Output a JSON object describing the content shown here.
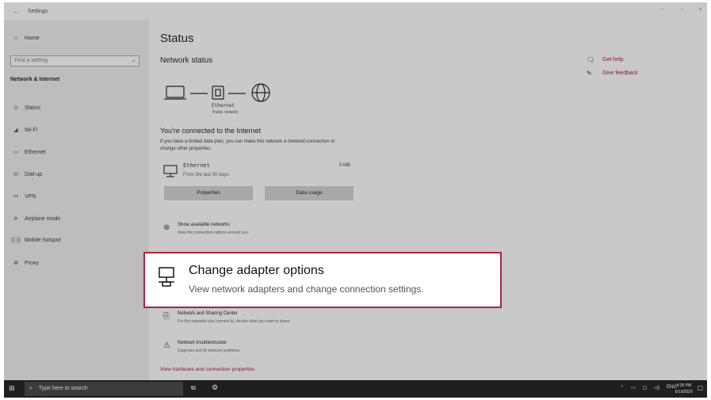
{
  "window": {
    "title": "Settings",
    "back_glyph": "←",
    "minimize": "–",
    "maximize": "▫",
    "close": "×"
  },
  "sidebar": {
    "home": "Home",
    "search_placeholder": "Find a setting",
    "section": "Network & Internet",
    "items": [
      {
        "label": "Status",
        "icon": "status-icon"
      },
      {
        "label": "Wi-Fi",
        "icon": "wifi-icon"
      },
      {
        "label": "Ethernet",
        "icon": "ethernet-icon"
      },
      {
        "label": "Dial-up",
        "icon": "dialup-icon"
      },
      {
        "label": "VPN",
        "icon": "vpn-icon"
      },
      {
        "label": "Airplane mode",
        "icon": "airplane-icon"
      },
      {
        "label": "Mobile hotspot",
        "icon": "hotspot-icon"
      },
      {
        "label": "Proxy",
        "icon": "proxy-icon"
      }
    ]
  },
  "main": {
    "title": "Status",
    "network_status": "Network status",
    "adapter_label": "Ethernet",
    "adapter_sub": "Public network",
    "connected": "You're connected to the Internet",
    "limited_text": "If you have a limited data plan, you can make this network a metered connection or change other properties.",
    "ethernet_row": {
      "name": "Ethernet",
      "sub": "From the last 30 days",
      "usage": "0 MB"
    },
    "buttons": {
      "properties": "Properties",
      "data_usage": "Data usage"
    },
    "show_networks": {
      "title": "Show available networks",
      "sub": "View the connection options around you."
    },
    "sharing_center": {
      "title": "Network and Sharing Center",
      "sub": "For the networks you connect to, decide what you want to share."
    },
    "troubleshooter": {
      "title": "Network troubleshooter",
      "sub": "Diagnose and fix network problems."
    },
    "hardware_link": "View hardware and connection properties"
  },
  "help": {
    "get_help": "Get help",
    "feedback": "Give feedback"
  },
  "callout": {
    "title": "Change adapter options",
    "subtitle": "View network adapters and change connection settings."
  },
  "taskbar": {
    "search_placeholder": "Type here to search",
    "language": "ENG",
    "time": "4:35 PM",
    "date": "6/19/2020"
  },
  "colors": {
    "accent": "#8b1538",
    "callout_border": "#b0203a"
  }
}
